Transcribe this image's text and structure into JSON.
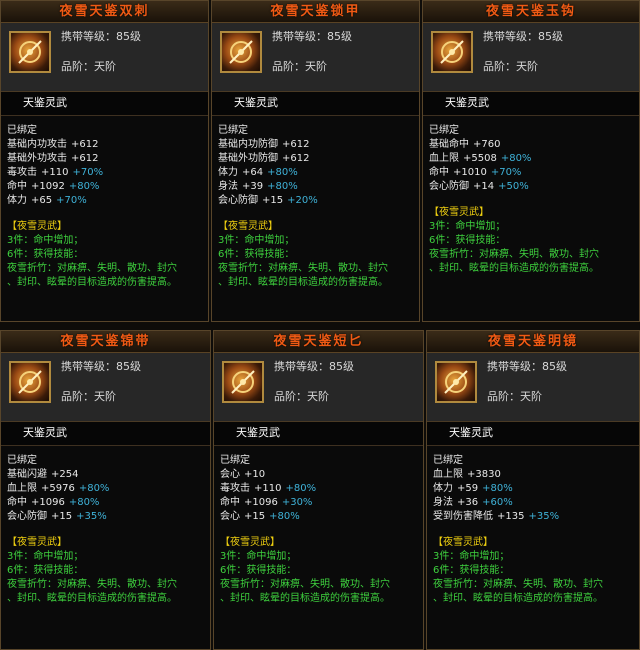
{
  "common": {
    "level_label": "携带等级：85级",
    "grade_label": "品阶：天阶",
    "linggu": "天鉴灵武",
    "bound": "已绑定",
    "set_title": "【夜雪灵武】",
    "set3": "3件：命中增加；",
    "set6": "6件：获得技能：",
    "skill_line1": "夜雪折竹：对麻痹、失明、散功、封穴",
    "skill_line2": "、封印、眩晕的目标造成的伤害提高。"
  },
  "cards": [
    {
      "title": "夜雪天鉴双刺",
      "icon": "dual-daggers-icon",
      "stats": [
        {
          "name": "基础内功攻击",
          "value": "+612",
          "extra": ""
        },
        {
          "name": "基础外功攻击",
          "value": "+612",
          "extra": ""
        },
        {
          "name": "毒攻击",
          "value": "+110",
          "extra": "+70%"
        },
        {
          "name": "命中",
          "value": "+1092",
          "extra": "+80%"
        },
        {
          "name": "体力",
          "value": "+65",
          "extra": "+70%"
        }
      ]
    },
    {
      "title": "夜雪天鉴锁甲",
      "icon": "armor-icon",
      "stats": [
        {
          "name": "基础内功防御",
          "value": "+612",
          "extra": ""
        },
        {
          "name": "基础外功防御",
          "value": "+612",
          "extra": ""
        },
        {
          "name": "体力",
          "value": "+64",
          "extra": "+80%"
        },
        {
          "name": "身法",
          "value": "+39",
          "extra": "+80%"
        },
        {
          "name": "会心防御",
          "value": "+15",
          "extra": "+20%"
        }
      ]
    },
    {
      "title": "夜雪天鉴玉钩",
      "icon": "jade-hook-icon",
      "stats": [
        {
          "name": "基础命中",
          "value": "+760",
          "extra": ""
        },
        {
          "name": "血上限",
          "value": "+5508",
          "extra": "+80%"
        },
        {
          "name": "命中",
          "value": "+1010",
          "extra": "+70%"
        },
        {
          "name": "会心防御",
          "value": "+14",
          "extra": "+50%"
        }
      ]
    },
    {
      "title": "夜雪天鉴锦带",
      "icon": "belt-icon",
      "stats": [
        {
          "name": "基础闪避",
          "value": "+254",
          "extra": ""
        },
        {
          "name": "血上限",
          "value": "+5976",
          "extra": "+80%"
        },
        {
          "name": "命中",
          "value": "+1096",
          "extra": "+80%"
        },
        {
          "name": "会心防御",
          "value": "+15",
          "extra": "+35%"
        }
      ]
    },
    {
      "title": "夜雪天鉴短匕",
      "icon": "short-dagger-icon",
      "stats": [
        {
          "name": "会心",
          "value": "+10",
          "extra": ""
        },
        {
          "name": "毒攻击",
          "value": "+110",
          "extra": "+80%"
        },
        {
          "name": "命中",
          "value": "+1096",
          "extra": "+30%"
        },
        {
          "name": "会心",
          "value": "+15",
          "extra": "+80%"
        }
      ]
    },
    {
      "title": "夜雪天鉴明镜",
      "icon": "mirror-icon",
      "stats": [
        {
          "name": "血上限",
          "value": "+3830",
          "extra": ""
        },
        {
          "name": "体力",
          "value": "+59",
          "extra": "+80%"
        },
        {
          "name": "身法",
          "value": "+36",
          "extra": "+60%"
        },
        {
          "name": "受到伤害降低",
          "value": "+135",
          "extra": "+35%"
        }
      ]
    }
  ]
}
